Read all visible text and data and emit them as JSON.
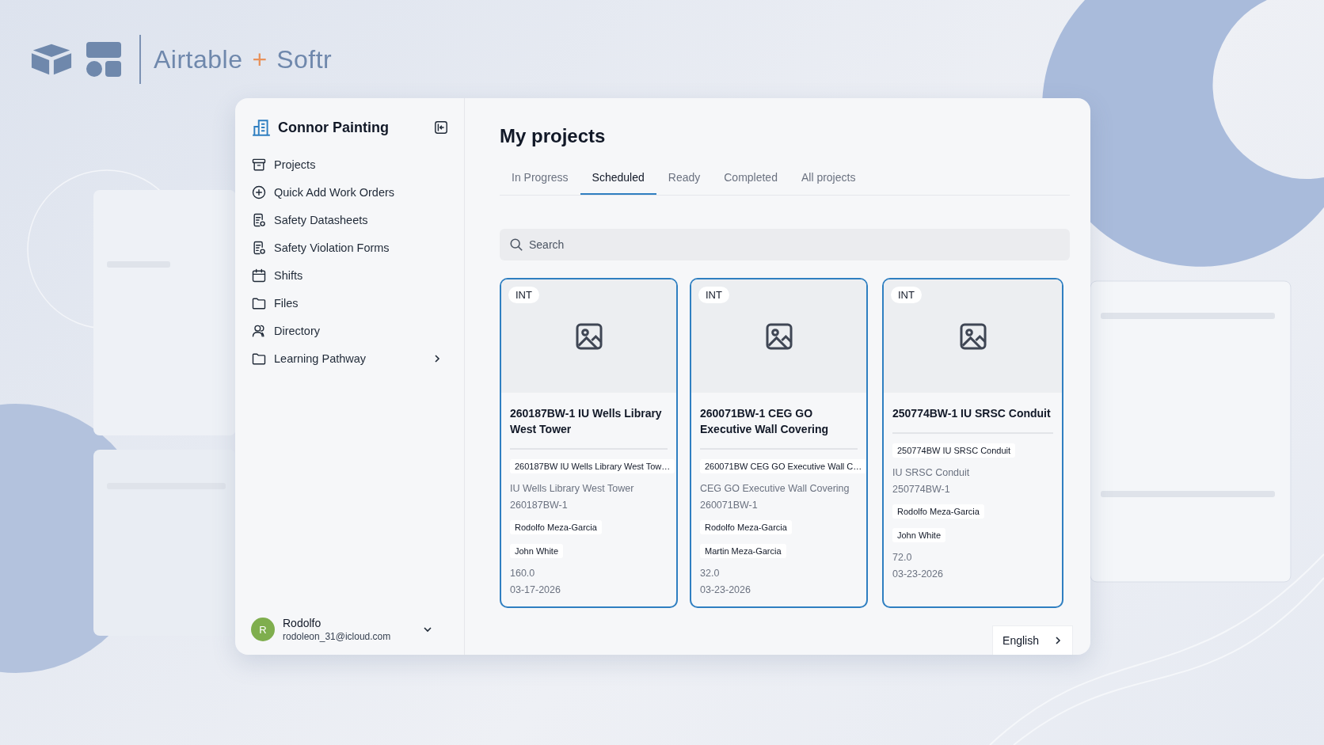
{
  "brand": {
    "left": "Airtable",
    "plus": "+",
    "right": "Softr"
  },
  "sidebar": {
    "title": "Connor Painting",
    "items": [
      {
        "label": "Projects",
        "expandable": false
      },
      {
        "label": "Quick Add Work Orders",
        "expandable": false
      },
      {
        "label": "Safety Datasheets",
        "expandable": false
      },
      {
        "label": "Safety Violation Forms",
        "expandable": false
      },
      {
        "label": "Shifts",
        "expandable": false
      },
      {
        "label": "Files",
        "expandable": false
      },
      {
        "label": "Directory",
        "expandable": false
      },
      {
        "label": "Learning Pathway",
        "expandable": true
      }
    ],
    "user": {
      "initial": "R",
      "name": "Rodolfo",
      "email": "rodoleon_31@icloud.com"
    }
  },
  "main": {
    "title": "My projects",
    "tabs": [
      {
        "label": "In Progress",
        "selected": false
      },
      {
        "label": "Scheduled",
        "selected": true
      },
      {
        "label": "Ready",
        "selected": false
      },
      {
        "label": "Completed",
        "selected": false
      },
      {
        "label": "All projects",
        "selected": false
      }
    ],
    "search": {
      "placeholder": "Search"
    },
    "cards": [
      {
        "tag": "INT",
        "title": "260187BW-1 IU Wells Library West Tower",
        "ref": "260187BW IU Wells Library West Tow…",
        "location": "IU Wells Library West Tower",
        "code": "260187BW-1",
        "people": [
          "Rodolfo Meza-Garcia",
          "John White"
        ],
        "hours": "160.0",
        "date": "03-17-2026"
      },
      {
        "tag": "INT",
        "title": "260071BW-1 CEG GO Executive Wall Covering",
        "ref": "260071BW CEG GO Executive Wall C…",
        "location": "CEG GO Executive Wall Covering",
        "code": "260071BW-1",
        "people": [
          "Rodolfo Meza-Garcia",
          "Martin Meza-Garcia"
        ],
        "hours": "32.0",
        "date": "03-23-2026"
      },
      {
        "tag": "INT",
        "title": "250774BW-1 IU SRSC Conduit",
        "ref": "250774BW IU SRSC Conduit",
        "location": "IU SRSC Conduit",
        "code": "250774BW-1",
        "people": [
          "Rodolfo Meza-Garcia",
          "John White"
        ],
        "hours": "72.0",
        "date": "03-23-2026"
      }
    ],
    "language": "English"
  }
}
